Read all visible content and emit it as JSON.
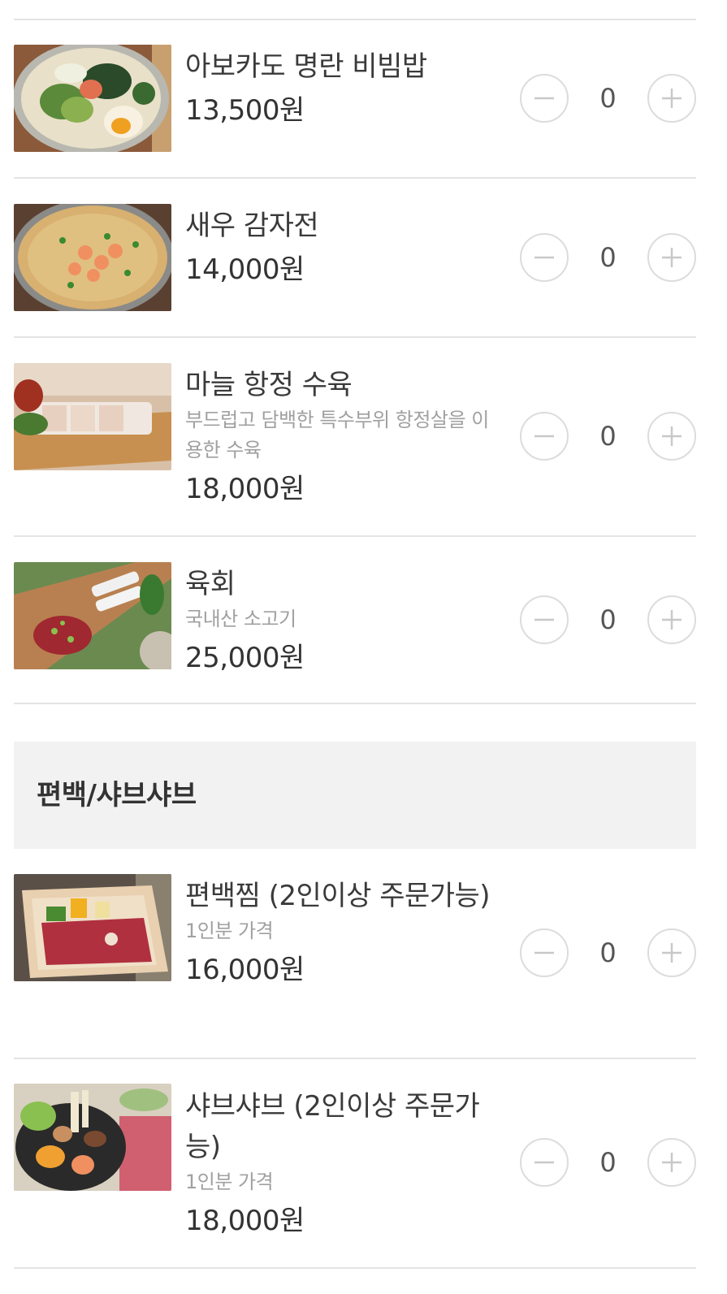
{
  "currency_suffix": "원",
  "section_title": "편백/샤브샤브",
  "colors": {
    "divider": "#e4e4e4",
    "section_bg": "#f2f2f2",
    "stepper_border": "#dcdcdc"
  },
  "items": [
    {
      "name": "아보카도 명란 비빔밥",
      "desc": "",
      "price": "13,500원",
      "qty": "0",
      "icon": "bibimbap-photo"
    },
    {
      "name": "새우 감자전",
      "desc": "",
      "price": "14,000원",
      "qty": "0",
      "icon": "shrimp-pancake-photo"
    },
    {
      "name": "마늘 항정 수육",
      "desc": "부드럽고 담백한 특수부위 항정살을 이용한 수육",
      "price": "18,000원",
      "qty": "0",
      "icon": "pork-suyuk-photo"
    },
    {
      "name": "육회",
      "desc": "국내산 소고기",
      "price": "25,000원",
      "qty": "0",
      "icon": "yukhoe-photo"
    },
    {
      "name": "편백찜 (2인이상 주문가능)",
      "desc": "1인분 가격",
      "price": "16,000원",
      "qty": "0",
      "icon": "steamed-box-photo"
    },
    {
      "name": "샤브샤브 (2인이상 주문가능)",
      "desc": "1인분 가격",
      "price": "18,000원",
      "qty": "0",
      "icon": "shabu-shabu-photo"
    }
  ]
}
